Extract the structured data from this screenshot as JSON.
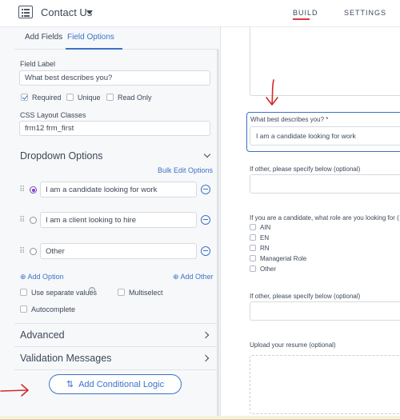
{
  "header": {
    "form_title": "Contact Us",
    "tabs": [
      "BUILD",
      "SETTINGS"
    ],
    "active_tab": "BUILD"
  },
  "sidebar": {
    "tabs": [
      "Add Fields",
      "Field Options"
    ],
    "active_tab": "Field Options",
    "field_label": {
      "label": "Field Label",
      "value": "What best describes you?"
    },
    "checkboxes": [
      {
        "label": "Required",
        "checked": true
      },
      {
        "label": "Unique",
        "checked": false
      },
      {
        "label": "Read Only",
        "checked": false
      }
    ],
    "css_classes": {
      "label": "CSS Layout Classes",
      "value": "frm12 frm_first"
    },
    "dropdown": {
      "title": "Dropdown Options",
      "bulk_edit": "Bulk Edit Options",
      "options": [
        {
          "value": "I am a candidate looking for work",
          "selected": true
        },
        {
          "value": "I am a client looking to hire",
          "selected": false
        },
        {
          "value": "Other",
          "selected": false
        }
      ],
      "add_option": "Add Option",
      "add_other": "Add Other",
      "use_separate_values": "Use separate values",
      "multiselect": "Multiselect",
      "autocomplete": "Autocomplete"
    },
    "sections": [
      "Advanced",
      "Validation Messages"
    ],
    "conditional_button": "Add Conditional Logic"
  },
  "canvas": {
    "selected_field": {
      "label": "What best describes you? *",
      "value": "I am a candidate looking for work"
    },
    "other_field_1": "If other, please specify below (optional)",
    "role_question": "If you are a candidate, what role are you looking for (",
    "role_options": [
      "AIN",
      "EN",
      "RN",
      "Managerial Role",
      "Other"
    ],
    "other_field_2": "If other, please specify below (optional)",
    "resume_label": "Upload your resume (optional)"
  },
  "colors": {
    "accent": "#3b73c6",
    "annotation": "#d42a2a",
    "radio_selected": "#7b3fc4"
  }
}
